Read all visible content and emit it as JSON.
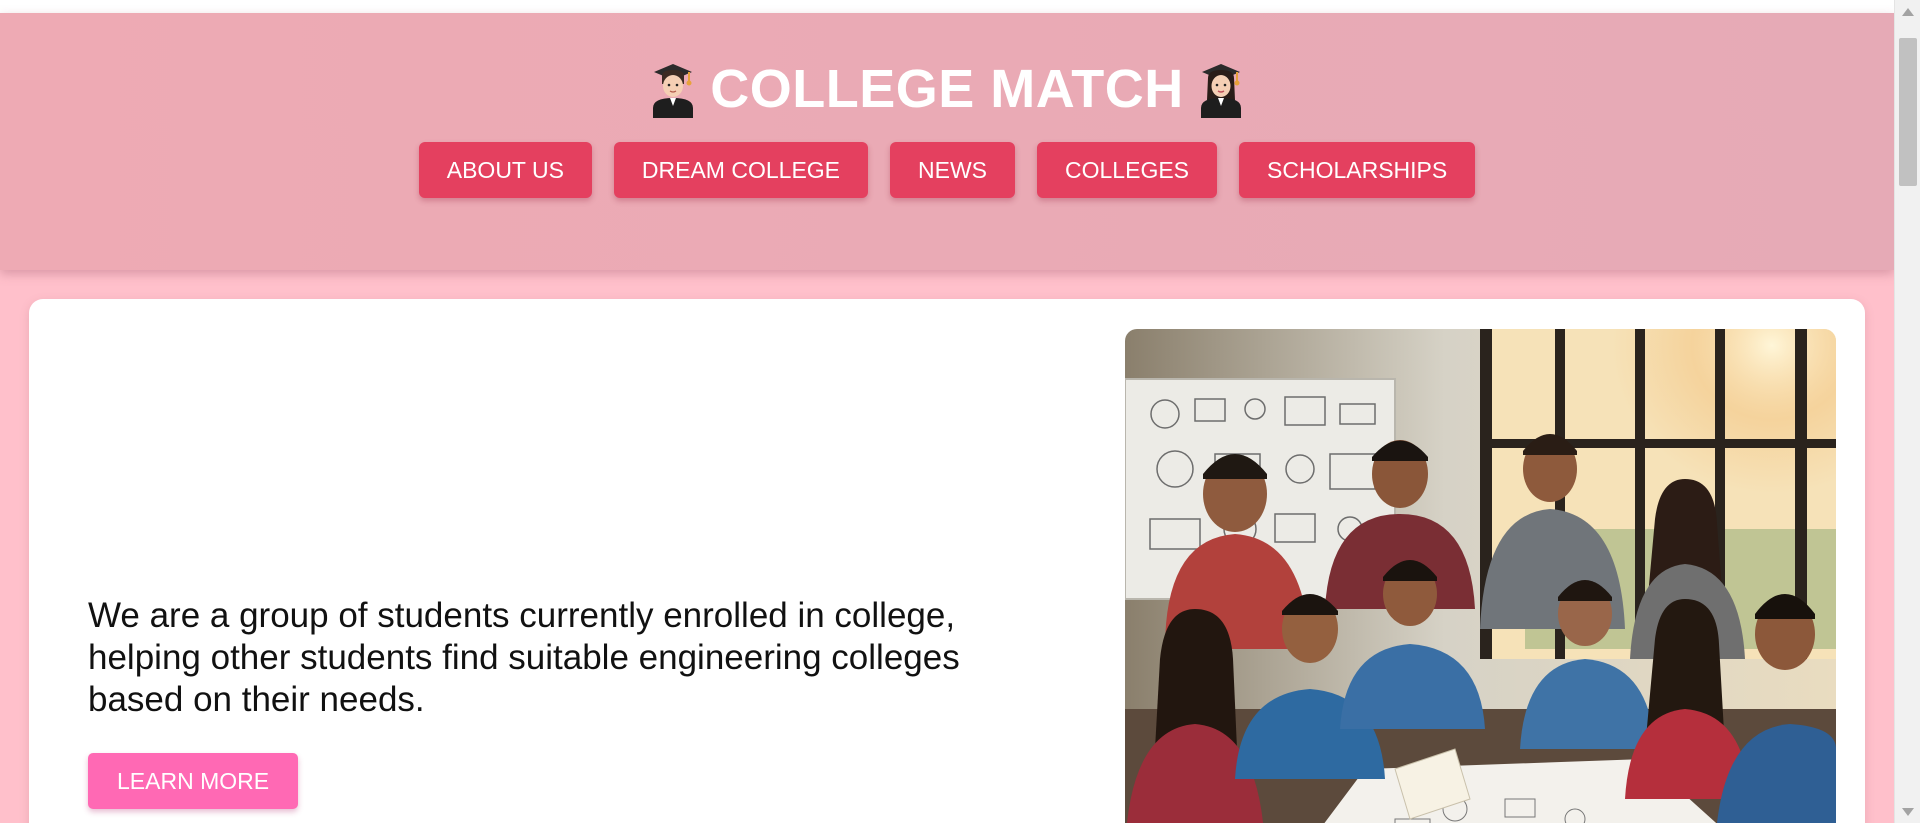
{
  "header": {
    "title": "COLLEGE MATCH",
    "left_icon": "student-man-graduate-icon",
    "right_icon": "student-woman-graduate-icon"
  },
  "nav": {
    "items": [
      {
        "label": "ABOUT US"
      },
      {
        "label": "DREAM COLLEGE"
      },
      {
        "label": "NEWS"
      },
      {
        "label": "COLLEGES"
      },
      {
        "label": "SCHOLARSHIPS"
      }
    ]
  },
  "intro": {
    "text": "We are a group of students currently enrolled in college, helping other students find suitable engineering colleges based on their needs.",
    "button_label": "LEARN MORE"
  },
  "hero": {
    "image": "students-studying-together-photo"
  },
  "colors": {
    "page_background": "#ffc0cb",
    "header_background": "#ebaab5",
    "nav_button": "#e4405f",
    "learn_more_button": "#ff69b4",
    "card_background": "#ffffff"
  }
}
